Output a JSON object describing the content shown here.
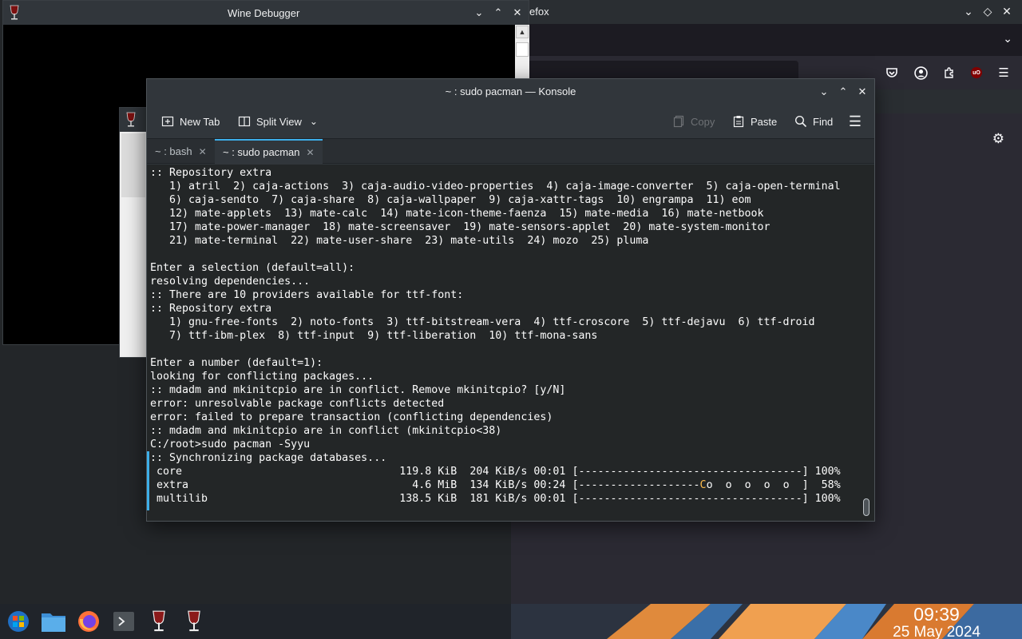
{
  "firefox": {
    "title": "efox",
    "url": "",
    "icons": [
      "pocket-icon",
      "account-icon",
      "extensions-icon",
      "ublock-icon",
      "menu-icon"
    ],
    "ublock_label": "uO"
  },
  "wine_debugger": {
    "title": "Wine Debugger"
  },
  "konsole": {
    "title": "~ : sudo pacman — Konsole",
    "toolbar": {
      "new_tab": "New Tab",
      "split_view": "Split View",
      "copy": "Copy",
      "paste": "Paste",
      "find": "Find"
    },
    "tabs": [
      {
        "label": "~ : bash",
        "active": false
      },
      {
        "label": "~ : sudo pacman",
        "active": true
      }
    ],
    "terminal_lines": [
      ":: Repository extra",
      "   1) atril  2) caja-actions  3) caja-audio-video-properties  4) caja-image-converter  5) caja-open-terminal",
      "   6) caja-sendto  7) caja-share  8) caja-wallpaper  9) caja-xattr-tags  10) engrampa  11) eom",
      "   12) mate-applets  13) mate-calc  14) mate-icon-theme-faenza  15) mate-media  16) mate-netbook",
      "   17) mate-power-manager  18) mate-screensaver  19) mate-sensors-applet  20) mate-system-monitor",
      "   21) mate-terminal  22) mate-user-share  23) mate-utils  24) mozo  25) pluma",
      "",
      "Enter a selection (default=all):",
      "resolving dependencies...",
      ":: There are 10 providers available for ttf-font:",
      ":: Repository extra",
      "   1) gnu-free-fonts  2) noto-fonts  3) ttf-bitstream-vera  4) ttf-croscore  5) ttf-dejavu  6) ttf-droid",
      "   7) ttf-ibm-plex  8) ttf-input  9) ttf-liberation  10) ttf-mona-sans",
      "",
      "Enter a number (default=1):",
      "looking for conflicting packages...",
      ":: mdadm and mkinitcpio are in conflict. Remove mkinitcpio? [y/N]",
      "error: unresolvable package conflicts detected",
      "error: failed to prepare transaction (conflicting dependencies)",
      ":: mdadm and mkinitcpio are in conflict (mkinitcpio<38)",
      "C:/root>sudo pacman -Syyu",
      ":: Synchronizing package databases..."
    ],
    "downloads": [
      {
        "name": "core",
        "size": "119.8 KiB",
        "rate": "204 KiB/s",
        "time": "00:01",
        "bar_done": "[-----------------------------------]",
        "bar_pac": "",
        "bar_rest": "",
        "percent": "100%"
      },
      {
        "name": "extra",
        "size": "4.6 MiB",
        "rate": "134 KiB/s",
        "time": "00:24",
        "bar_done": "[-------------------",
        "bar_pac": "C",
        "bar_rest": "o  o  o  o  o  ]",
        "percent": "58%"
      },
      {
        "name": "multilib",
        "size": "138.5 KiB",
        "rate": "181 KiB/s",
        "time": "00:01",
        "bar_done": "[-----------------------------------]",
        "bar_pac": "",
        "bar_rest": "",
        "percent": "100%"
      }
    ]
  },
  "taskbar": {
    "apps": [
      "start-menu-icon",
      "file-manager-icon",
      "firefox-icon",
      "terminal-icon",
      "wine-icon",
      "wine-icon"
    ],
    "time": "09:39",
    "date": "25 May 2024"
  },
  "colors": {
    "accent": "#3daee9",
    "pacman": "#fdbc4b",
    "terminal_bg": "#232627",
    "window_bg": "#31363b"
  }
}
